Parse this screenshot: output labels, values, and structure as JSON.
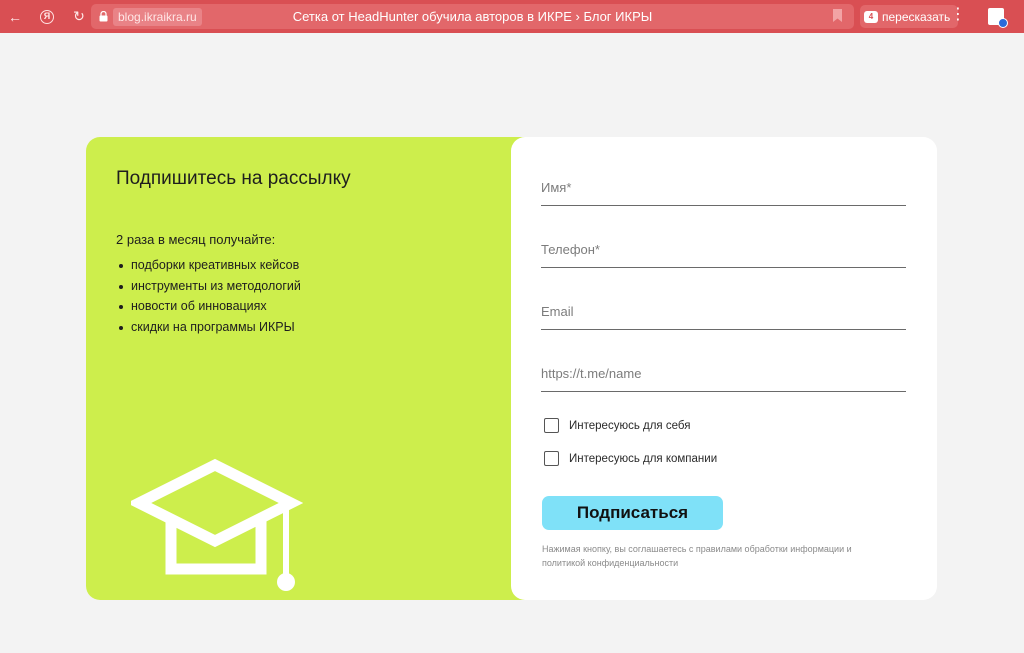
{
  "browser": {
    "domain": "blog.ikraikra.ru",
    "page_title": "Сетка от HeadHunter обучила авторов в ИКРЕ › Блог ИКРЫ",
    "retell_label": "пересказать",
    "yandex_glyph": "Я",
    "retell_badge": "4",
    "menu_glyph": "⋮",
    "back_glyph": "←",
    "reload_glyph": "↻",
    "accent_color": "#d94f53"
  },
  "promo": {
    "title": "Подпишитесь на рассылку",
    "intro": "2 раза в месяц получайте:",
    "benefits": [
      "подборки креативных кейсов",
      "инструменты из методологий",
      "новости об инновациях",
      "скидки на программы ИКРЫ"
    ],
    "background_color": "#cdee4c",
    "icon": "graduation-cap-icon"
  },
  "form": {
    "name_placeholder": "Имя*",
    "phone_placeholder": "Телефон*",
    "email_placeholder": "Email",
    "telegram_placeholder": "https://t.me/name",
    "checkbox_self": "Интересуюсь для себя",
    "checkbox_company": "Интересуюсь для компании",
    "submit_label": "Подписаться",
    "submit_color": "#7fe1f8",
    "disclaimer": "Нажимая кнопку, вы соглашаетесь с правилами обработки информации и политикой конфиденциальности"
  }
}
